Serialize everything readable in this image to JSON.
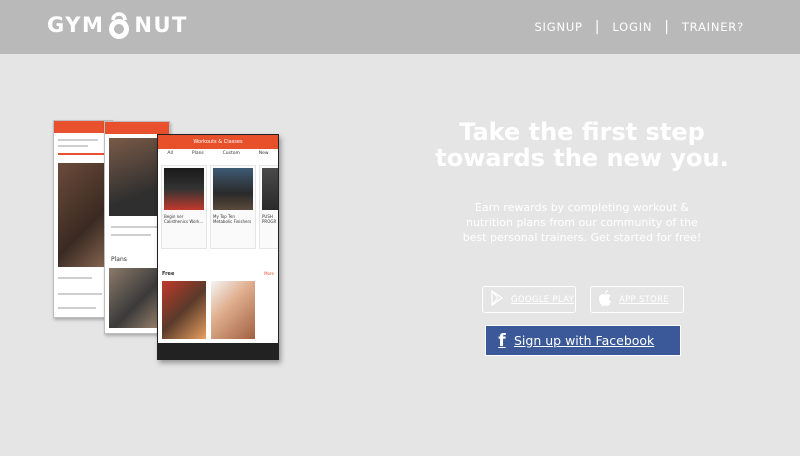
{
  "header": {
    "logo_text_left": "GYM",
    "logo_text_right": "NUT",
    "nav": [
      {
        "label": "SIGNUP"
      },
      {
        "label": "LOGIN"
      },
      {
        "label": "TRAINER?"
      }
    ],
    "separator": "|"
  },
  "hero": {
    "headline_line1": "Take the first step",
    "headline_line2": "towards the new you.",
    "subtext": "Earn rewards by completing workout & nutrition plans from our community of the best personal trainers. Get started for free!",
    "google_play_label": "GOOGLE PLAY",
    "app_store_label": "APP STORE",
    "facebook_label": "Sign up with Facebook",
    "facebook_icon": "f"
  },
  "phones": {
    "screen3_title": "Workouts & Classes",
    "tabs": [
      "All",
      "Plans",
      "Custom",
      "New"
    ],
    "section_plans": "Plans",
    "section_free": "Free",
    "card1_title": "Begin ner Calisthenics Work...",
    "card2_title": "My Top Ten Metabolic Finishers",
    "card3_title": "PUSH PROGR",
    "more_label": "More"
  },
  "colors": {
    "header_bg": "#b9b9b9",
    "page_bg": "#e5e5e5",
    "app_accent": "#e8502e",
    "facebook_blue": "#3b5998"
  }
}
